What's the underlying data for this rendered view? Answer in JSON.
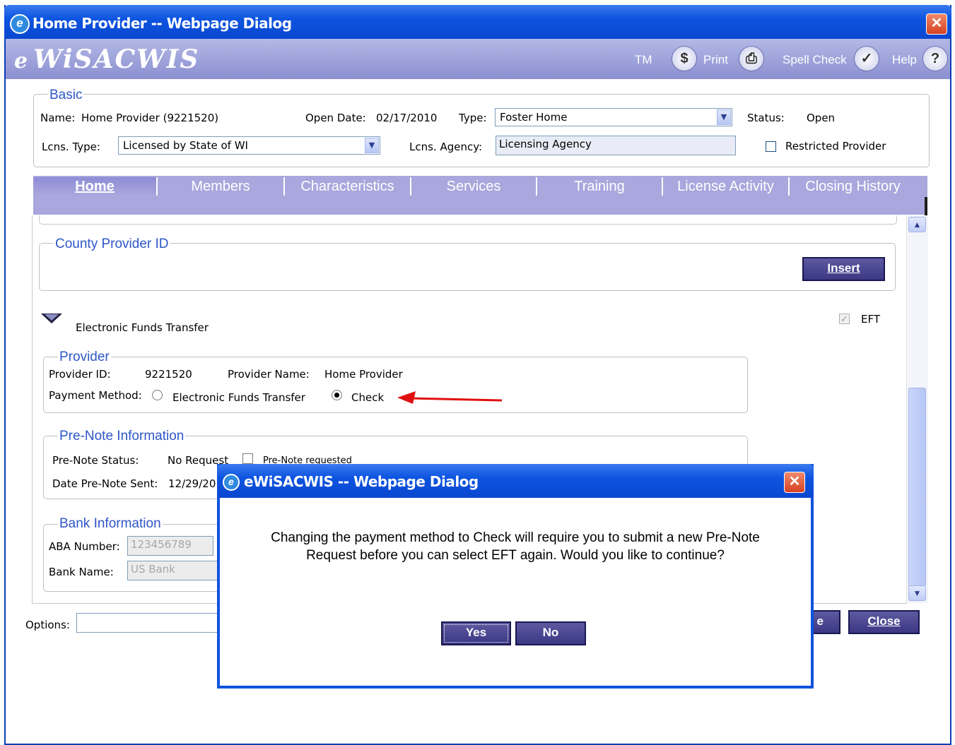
{
  "window": {
    "title": "Home Provider -- Webpage Dialog",
    "close": "✕"
  },
  "appbar": {
    "brand_e": "e",
    "brand": "WiSACWIS",
    "tm": "TM",
    "print": "Print",
    "spell_check": "Spell Check",
    "help": "Help",
    "icon_tm": "$",
    "icon_print": "⎙",
    "icon_spell": "✓",
    "icon_help": "?"
  },
  "basic": {
    "legend": "Basic",
    "name_label": "Name:",
    "name_value": "Home Provider (9221520)",
    "open_date_label": "Open Date:",
    "open_date_value": "02/17/2010",
    "type_label": "Type:",
    "type_value": "Foster Home",
    "status_label": "Status:",
    "status_value": "Open",
    "lcns_type_label": "Lcns. Type:",
    "lcns_type_value": "Licensed by State of WI",
    "lcns_agency_label": "Lcns. Agency:",
    "lcns_agency_value": "Licensing Agency",
    "restricted_label": "Restricted Provider"
  },
  "tabs": [
    {
      "label": "Home"
    },
    {
      "label": "Members"
    },
    {
      "label": "Characteristics"
    },
    {
      "label": "Services"
    },
    {
      "label": "Training"
    },
    {
      "label": "License Activity"
    },
    {
      "label": "Closing History"
    }
  ],
  "county": {
    "legend": "County Provider ID",
    "insert": "Insert"
  },
  "eft": {
    "section_label": "Electronic Funds Transfer",
    "checkbox_label": "EFT",
    "checkbox_mark": "✓"
  },
  "provider": {
    "legend": "Provider",
    "id_label": "Provider ID:",
    "id_value": "9221520",
    "name_label": "Provider Name:",
    "name_value": "Home Provider",
    "payment_label": "Payment Method:",
    "opt_eft": "Electronic Funds Transfer",
    "opt_check": "Check"
  },
  "prenote": {
    "legend": "Pre-Note Information",
    "status_label": "Pre-Note Status:",
    "status_value": "No Request",
    "requested_label": "Pre-Note requested",
    "date_label": "Date Pre-Note Sent:",
    "date_value": "12/29/20"
  },
  "bank": {
    "legend": "Bank Information",
    "aba_label": "ABA Number:",
    "aba_value": "123456789",
    "name_label": "Bank Name:",
    "name_value": "US Bank"
  },
  "footer": {
    "options_label": "Options:",
    "save_partial": "e",
    "close": "Close"
  },
  "modal": {
    "title": "eWiSACWIS -- Webpage Dialog",
    "close": "✕",
    "message_line1": "Changing the payment method to Check will require you to submit a new Pre-Note",
    "message_line2": "Request before you can select EFT again. Would you like to continue?",
    "yes": "Yes",
    "no": "No"
  },
  "colors": {
    "title_blue": "#0d54e0",
    "brand_bar": "#9ca0da",
    "legend_blue": "#2e56c8",
    "button": "#3b3784",
    "arrow_red": "#e01010"
  }
}
